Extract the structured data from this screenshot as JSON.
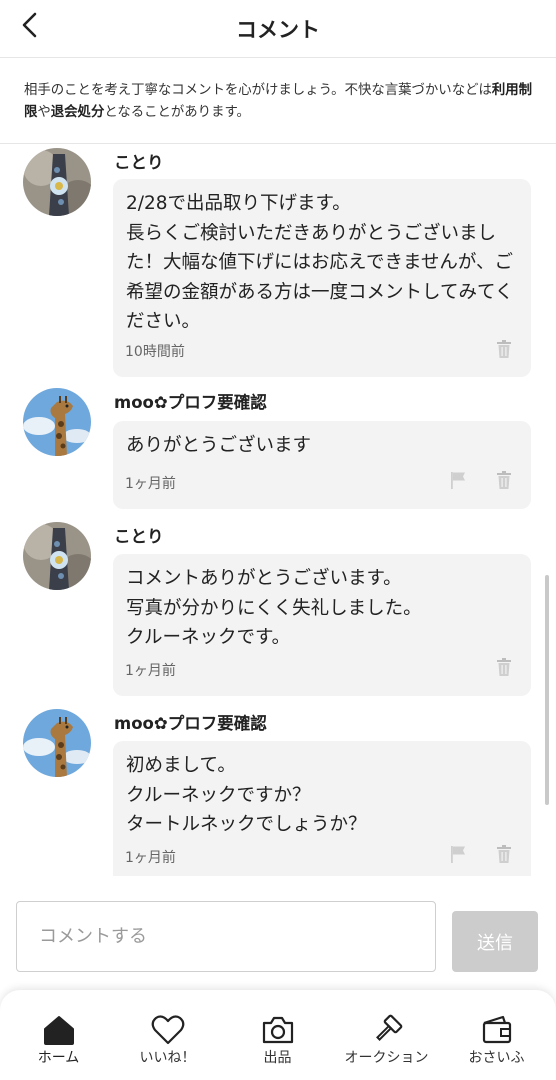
{
  "header": {
    "title": "コメント",
    "back_icon": "chevron-left-icon"
  },
  "notice": {
    "part1": "相手のことを考え丁寧なコメントを心がけましょう。不快な言葉づかいなどは",
    "bold1": "利用制限",
    "part2": "や",
    "bold2": "退会処分",
    "part3": "となることがあります。"
  },
  "comments": [
    {
      "username": "ことり",
      "avatar": "kotori-avatar",
      "text": "2/28で出品取り下げます。\n長らくご検討いただきありがとうございました！大幅な値下げにはお応えできませんが、ご希望の金額がある方は一度コメントしてみてください。",
      "time": "10時間前",
      "actions": [
        "trash-icon"
      ]
    },
    {
      "username": "moo✿プロフ要確認",
      "avatar": "giraffe-avatar",
      "text": "ありがとうございます",
      "time": "1ヶ月前",
      "actions": [
        "flag-icon",
        "trash-icon"
      ]
    },
    {
      "username": "ことり",
      "avatar": "kotori-avatar",
      "text": "コメントありがとうございます。\n写真が分かりにくく失礼しました。\nクルーネックです。",
      "time": "1ヶ月前",
      "actions": [
        "trash-icon"
      ]
    },
    {
      "username": "moo✿プロフ要確認",
      "avatar": "giraffe-avatar",
      "text": "初めまして。\nクルーネックですか？\nタートルネックでしょうか？",
      "time": "1ヶ月前",
      "actions": [
        "flag-icon",
        "trash-icon"
      ]
    }
  ],
  "input": {
    "placeholder": "コメントする",
    "value": "",
    "send_label": "送信"
  },
  "nav": {
    "items": [
      {
        "label": "ホーム",
        "icon": "home-icon",
        "active": true
      },
      {
        "label": "いいね！",
        "icon": "heart-icon",
        "active": false
      },
      {
        "label": "出品",
        "icon": "camera-icon",
        "active": false
      },
      {
        "label": "オークション",
        "icon": "gavel-icon",
        "active": false
      },
      {
        "label": "おさいふ",
        "icon": "wallet-icon",
        "active": false
      }
    ]
  },
  "colors": {
    "bubble_bg": "#f3f3f3",
    "send_button_disabled": "#cccccc",
    "divider": "#e6e6e6"
  }
}
